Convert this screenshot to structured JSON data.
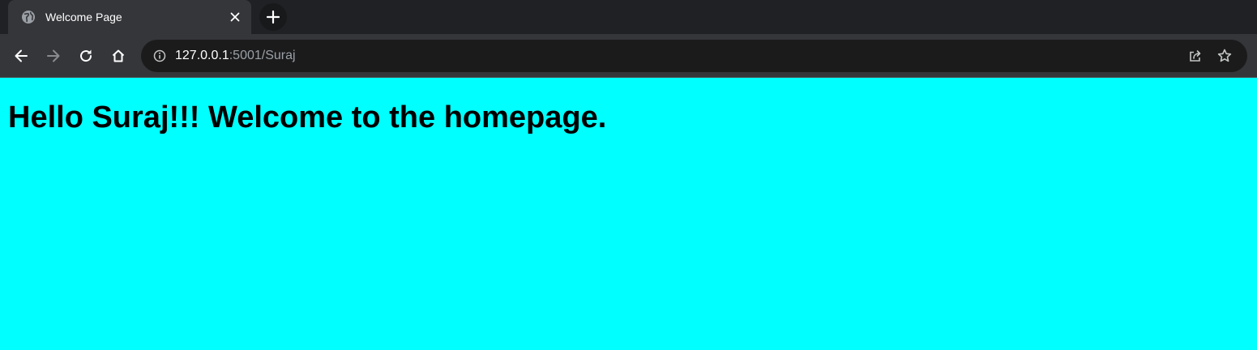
{
  "colors": {
    "tab_strip_bg": "#202124",
    "toolbar_bg": "#35363a",
    "omnibox_bg": "#1b1b1c",
    "page_bg": "#00ffff",
    "heading_color": "#000000"
  },
  "tab": {
    "favicon": "globe-icon",
    "title": "Welcome Page",
    "close_icon": "close-icon"
  },
  "new_tab_icon": "plus-icon",
  "toolbar": {
    "back_icon": "arrow-left-icon",
    "forward_icon": "arrow-right-icon",
    "reload_icon": "reload-icon",
    "home_icon": "home-icon",
    "share_icon": "share-icon",
    "bookmark_icon": "star-icon"
  },
  "address_bar": {
    "info_icon": "info-icon",
    "url_host": "127.0.0.1",
    "url_rest": ":5001/Suraj"
  },
  "page": {
    "heading": "Hello Suraj!!! Welcome to the homepage."
  }
}
